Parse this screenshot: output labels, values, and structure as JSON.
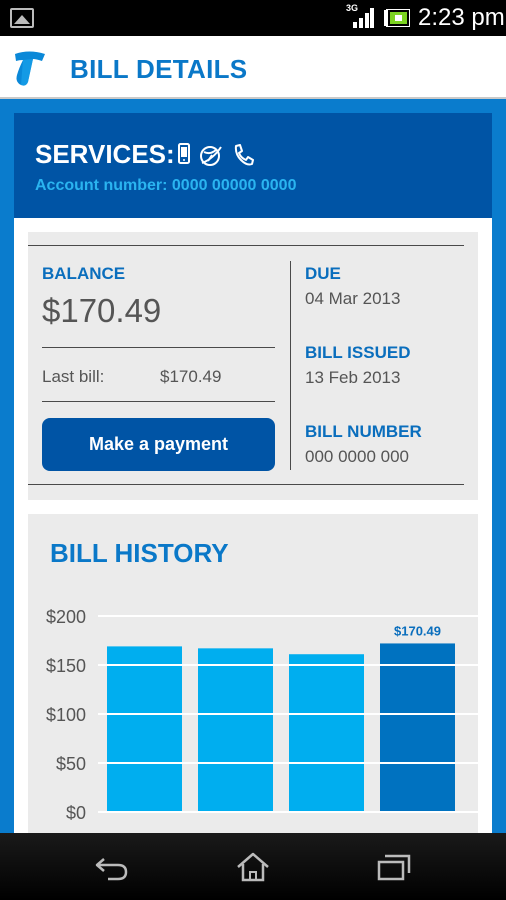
{
  "status_bar": {
    "network": "3G",
    "time": "2:23 pm"
  },
  "app_bar": {
    "title": "BILL DETAILS"
  },
  "services": {
    "title": "SERVICES:",
    "icons": [
      "mobile-phone-icon",
      "internet-globe-icon",
      "landline-phone-icon"
    ],
    "account_number": "Account number: 0000 00000 0000"
  },
  "bill": {
    "balance_label": "BALANCE",
    "balance_amount": "$170.49",
    "last_bill_label": "Last bill:",
    "last_bill_amount": "$170.49",
    "pay_button": "Make a payment",
    "due_label": "DUE",
    "due_date": "04 Mar 2013",
    "issued_label": "BILL ISSUED",
    "issued_date": "13 Feb 2013",
    "number_label": "BILL NUMBER",
    "number_value": "000 0000 000"
  },
  "history": {
    "title": "BILL HISTORY"
  },
  "chart_data": {
    "type": "bar",
    "values": [
      169,
      167,
      161,
      172
    ],
    "yticks": [
      "$200",
      "$150",
      "$100",
      "$50",
      "$0"
    ],
    "ylim": [
      0,
      200
    ],
    "highlight_index": 3,
    "highlight_label": "$170.49",
    "colors": {
      "normal": "#00aeef",
      "highlight": "#0072c0",
      "grid": "#ffffff",
      "label": "#0a6ebd"
    }
  },
  "nav_bar": {
    "buttons": [
      "back-icon",
      "home-icon",
      "recent-apps-icon"
    ]
  },
  "colors": {
    "brand_blue": "#0a78c8",
    "dark_blue": "#0054a5",
    "accent_cyan": "#2ab4f0"
  }
}
